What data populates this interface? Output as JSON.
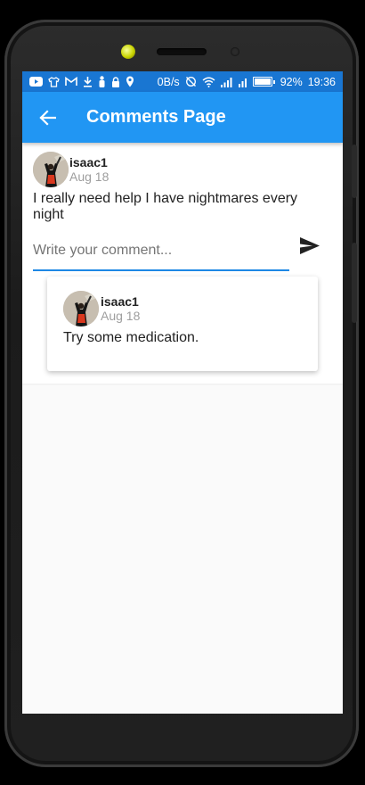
{
  "status_bar": {
    "network_speed": "0B/s",
    "battery_percent": "92%",
    "battery_level": 0.92,
    "time": "19:36",
    "icons": [
      "youtube-icon",
      "shirt-icon",
      "gmail-icon",
      "download-icon",
      "person-icon",
      "lock-icon",
      "location-icon",
      "sync-off-icon",
      "wifi-icon",
      "signal-icon",
      "signal-icon"
    ]
  },
  "app_bar": {
    "title": "Comments Page",
    "back_icon": "arrow-back-icon"
  },
  "post": {
    "username": "isaac1",
    "date": "Aug 18",
    "text": "I really need help I have nightmares every night"
  },
  "comment_input": {
    "placeholder": "Write your comment...",
    "value": ""
  },
  "comments": [
    {
      "username": "isaac1",
      "date": "Aug 18",
      "text": "Try some medication."
    }
  ],
  "colors": {
    "status_bar": "#1976d2",
    "app_bar": "#2196f3",
    "input_underline": "#1e88e5"
  }
}
